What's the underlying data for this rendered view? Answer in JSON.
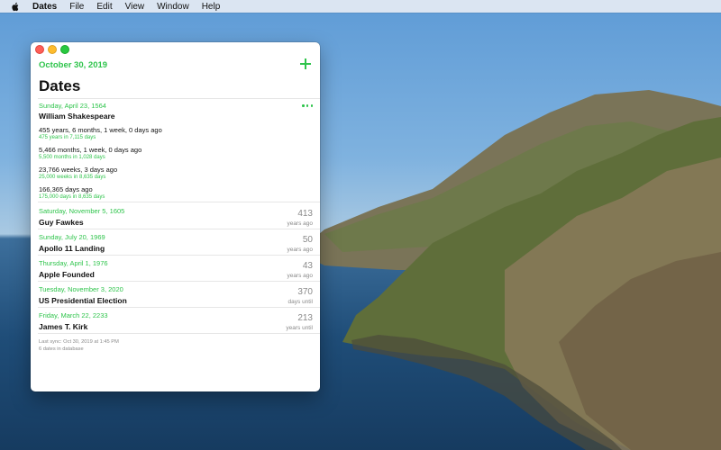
{
  "menubar": {
    "app_name": "Dates",
    "items": [
      "File",
      "Edit",
      "View",
      "Window",
      "Help"
    ]
  },
  "window": {
    "header_date": "October 30, 2019",
    "title": "Dates",
    "expanded": {
      "date": "Sunday, April 23, 1564",
      "name": "William Shakespeare",
      "stats": [
        {
          "main": "455 years, 6 months, 1 week, 0 days ago",
          "sub": "475 years in 7,115 days"
        },
        {
          "main": "5,466 months, 1 week, 0 days ago",
          "sub": "5,500 months in 1,028 days"
        },
        {
          "main": "23,766 weeks, 3 days ago",
          "sub": "25,000 weeks in 8,635 days"
        },
        {
          "main": "166,365 days ago",
          "sub": "175,000 days in 8,635 days"
        }
      ]
    },
    "rows": [
      {
        "date": "Saturday, November 5, 1605",
        "name": "Guy Fawkes",
        "number": "413",
        "unit": "years ago"
      },
      {
        "date": "Sunday, July 20, 1969",
        "name": "Apollo 11 Landing",
        "number": "50",
        "unit": "years ago"
      },
      {
        "date": "Thursday, April 1, 1976",
        "name": "Apple Founded",
        "number": "43",
        "unit": "years ago"
      },
      {
        "date": "Tuesday, November 3, 2020",
        "name": "US Presidential Election",
        "number": "370",
        "unit": "days until"
      },
      {
        "date": "Friday, March 22, 2233",
        "name": "James T. Kirk",
        "number": "213",
        "unit": "years until"
      }
    ],
    "footer": {
      "sync": "Last sync: Oct 30, 2019 at 1:45 PM",
      "count": "6 dates in database"
    }
  },
  "colors": {
    "accent": "#2ec44b",
    "muted": "#8a8a8a"
  },
  "icons": [
    "apple-icon",
    "add-icon",
    "more-icon"
  ]
}
